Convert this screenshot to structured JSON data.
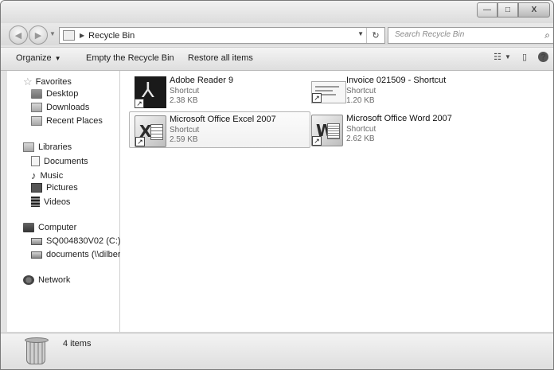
{
  "window": {
    "caption_buttons": {
      "minimize": "—",
      "maximize": "□",
      "close": "X"
    }
  },
  "address": {
    "path": "Recycle Bin",
    "refresh_glyph": "↻"
  },
  "search": {
    "placeholder": "Search Recycle Bin"
  },
  "toolbar": {
    "organize": "Organize",
    "empty": "Empty the Recycle Bin",
    "restore": "Restore all items"
  },
  "nav": {
    "favorites": {
      "title": "Favorites",
      "items": [
        "Desktop",
        "Downloads",
        "Recent Places"
      ]
    },
    "libraries": {
      "title": "Libraries",
      "items": [
        "Documents",
        "Music",
        "Pictures",
        "Videos"
      ]
    },
    "computer": {
      "title": "Computer",
      "items": [
        "SQ004830V02 (C:)",
        "documents (\\\\dilbert"
      ]
    },
    "network": {
      "title": "Network"
    }
  },
  "files": [
    {
      "name": "Adobe Reader 9",
      "type": "Shortcut",
      "size": "2.38 KB",
      "icon": "adobe-reader-icon"
    },
    {
      "name": "Invoice 021509 - Shortcut",
      "type": "Shortcut",
      "size": "1.20 KB",
      "icon": "document-icon"
    },
    {
      "name": "Microsoft Office Excel 2007",
      "type": "Shortcut",
      "size": "2.59 KB",
      "icon": "excel-icon",
      "selected": true
    },
    {
      "name": "Microsoft Office Word 2007",
      "type": "Shortcut",
      "size": "2.62 KB",
      "icon": "word-icon"
    }
  ],
  "status": {
    "count": "4 items"
  }
}
